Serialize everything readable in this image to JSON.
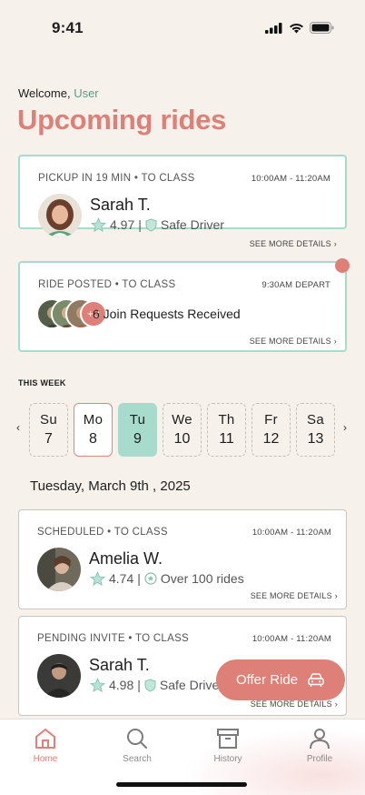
{
  "status": {
    "time": "9:41"
  },
  "welcome": {
    "prefix": "Welcome,",
    "user": "User"
  },
  "title": "Upcoming rides",
  "cards": [
    {
      "meta": "PICKUP IN 19 MIN • TO CLASS",
      "time": "10:00AM - 11:20AM",
      "name": "Sarah T.",
      "rating": "4.97",
      "badge": "Safe Driver",
      "more": "SEE MORE DETAILS"
    },
    {
      "meta": "RIDE POSTED • TO CLASS",
      "time": "9:30AM DEPART",
      "extra_count": "+3",
      "requests": "6 Join Requests Received",
      "more": "SEE MORE DETAILS"
    }
  ],
  "week": {
    "label": "THIS WEEK",
    "prev": "‹",
    "next": "›",
    "days": [
      {
        "name": "Su",
        "date": "7"
      },
      {
        "name": "Mo",
        "date": "8"
      },
      {
        "name": "Tu",
        "date": "9"
      },
      {
        "name": "We",
        "date": "10"
      },
      {
        "name": "Th",
        "date": "11"
      },
      {
        "name": "Fr",
        "date": "12"
      },
      {
        "name": "Sa",
        "date": "13"
      }
    ]
  },
  "date_heading": "Tuesday, March 9th , 2025",
  "rides": [
    {
      "meta": "SCHEDULED • TO CLASS",
      "time": "10:00AM - 11:20AM",
      "name": "Amelia W.",
      "rating": "4.74",
      "badge": "Over 100 rides",
      "more": "SEE MORE DETAILS"
    },
    {
      "meta": "PENDING INVITE • TO CLASS",
      "time": "10:00AM - 11:20AM",
      "name": "Sarah T.",
      "rating": "4.98",
      "badge": "Safe Driver",
      "more": "SEE MORE DETAILS"
    }
  ],
  "offer_button": "Offer Ride",
  "tabs": [
    {
      "label": "Home",
      "icon": "home-icon"
    },
    {
      "label": "Search",
      "icon": "search-icon"
    },
    {
      "label": "History",
      "icon": "archive-icon"
    },
    {
      "label": "Profile",
      "icon": "user-icon"
    }
  ],
  "colors": {
    "accent": "#de8077",
    "mint": "#a7dccd",
    "green_text": "#5d9b86",
    "background": "#f6f1ea"
  }
}
